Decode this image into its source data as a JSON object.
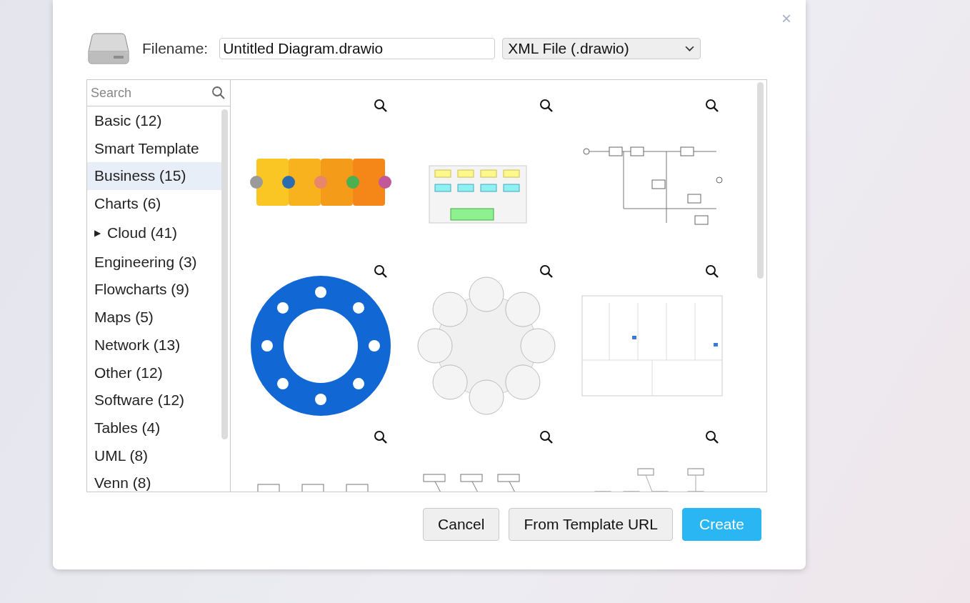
{
  "dialog": {
    "close": "×"
  },
  "filename": {
    "label": "Filename:",
    "value": "Untitled Diagram.drawio"
  },
  "format": {
    "value": "XML File (.drawio)"
  },
  "search": {
    "placeholder": "Search"
  },
  "categories": [
    {
      "label": "Basic (12)",
      "selected": false
    },
    {
      "label": "Smart Template",
      "selected": false
    },
    {
      "label": "Business (15)",
      "selected": true
    },
    {
      "label": "Charts (6)",
      "selected": false
    },
    {
      "label": "Cloud (41)",
      "selected": false,
      "expanded": false,
      "toggle": "▶"
    },
    {
      "label": "Engineering (3)",
      "selected": false
    },
    {
      "label": "Flowcharts (9)",
      "selected": false
    },
    {
      "label": "Maps (5)",
      "selected": false
    },
    {
      "label": "Network (13)",
      "selected": false
    },
    {
      "label": "Other (12)",
      "selected": false
    },
    {
      "label": "Software (12)",
      "selected": false
    },
    {
      "label": "Tables (4)",
      "selected": false
    },
    {
      "label": "UML (8)",
      "selected": false
    },
    {
      "label": "Venn (8)",
      "selected": false
    }
  ],
  "buttons": [
    {
      "label": "Cancel",
      "kind": "plain"
    },
    {
      "label": "From Template URL",
      "kind": "plain"
    },
    {
      "label": "Create",
      "kind": "primary"
    }
  ]
}
